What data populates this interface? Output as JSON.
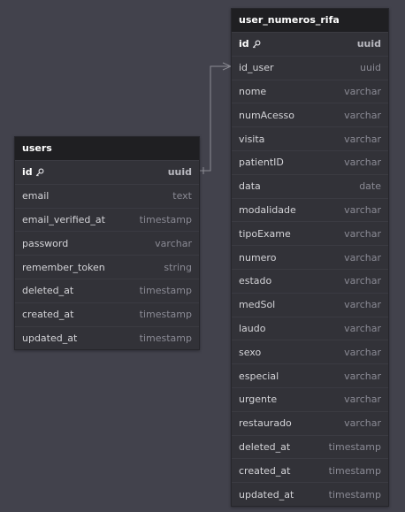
{
  "tables": {
    "users": {
      "name": "users",
      "columns": [
        {
          "name": "id",
          "type": "uuid",
          "pk": true
        },
        {
          "name": "email",
          "type": "text"
        },
        {
          "name": "email_verified_at",
          "type": "timestamp"
        },
        {
          "name": "password",
          "type": "varchar"
        },
        {
          "name": "remember_token",
          "type": "string"
        },
        {
          "name": "deleted_at",
          "type": "timestamp"
        },
        {
          "name": "created_at",
          "type": "timestamp"
        },
        {
          "name": "updated_at",
          "type": "timestamp"
        }
      ]
    },
    "rifa": {
      "name": "user_numeros_rifa",
      "columns": [
        {
          "name": "id",
          "type": "uuid",
          "pk": true
        },
        {
          "name": "id_user",
          "type": "uuid"
        },
        {
          "name": "nome",
          "type": "varchar"
        },
        {
          "name": "numAcesso",
          "type": "varchar"
        },
        {
          "name": "visita",
          "type": "varchar"
        },
        {
          "name": "patientID",
          "type": "varchar"
        },
        {
          "name": "data",
          "type": "date"
        },
        {
          "name": "modalidade",
          "type": "varchar"
        },
        {
          "name": "tipoExame",
          "type": "varchar"
        },
        {
          "name": "numero",
          "type": "varchar"
        },
        {
          "name": "estado",
          "type": "varchar"
        },
        {
          "name": "medSol",
          "type": "varchar"
        },
        {
          "name": "laudo",
          "type": "varchar"
        },
        {
          "name": "sexo",
          "type": "varchar"
        },
        {
          "name": "especial",
          "type": "varchar"
        },
        {
          "name": "urgente",
          "type": "varchar"
        },
        {
          "name": "restaurado",
          "type": "varchar"
        },
        {
          "name": "deleted_at",
          "type": "timestamp"
        },
        {
          "name": "created_at",
          "type": "timestamp"
        },
        {
          "name": "updated_at",
          "type": "timestamp"
        }
      ]
    }
  },
  "relationship": {
    "from": "users.id",
    "to": "user_numeros_rifa.id_user",
    "type": "one-to-many"
  },
  "colors": {
    "background": "#42424c",
    "table_body": "#323238",
    "table_header": "#1f1f22",
    "connector": "#8c8c94"
  }
}
